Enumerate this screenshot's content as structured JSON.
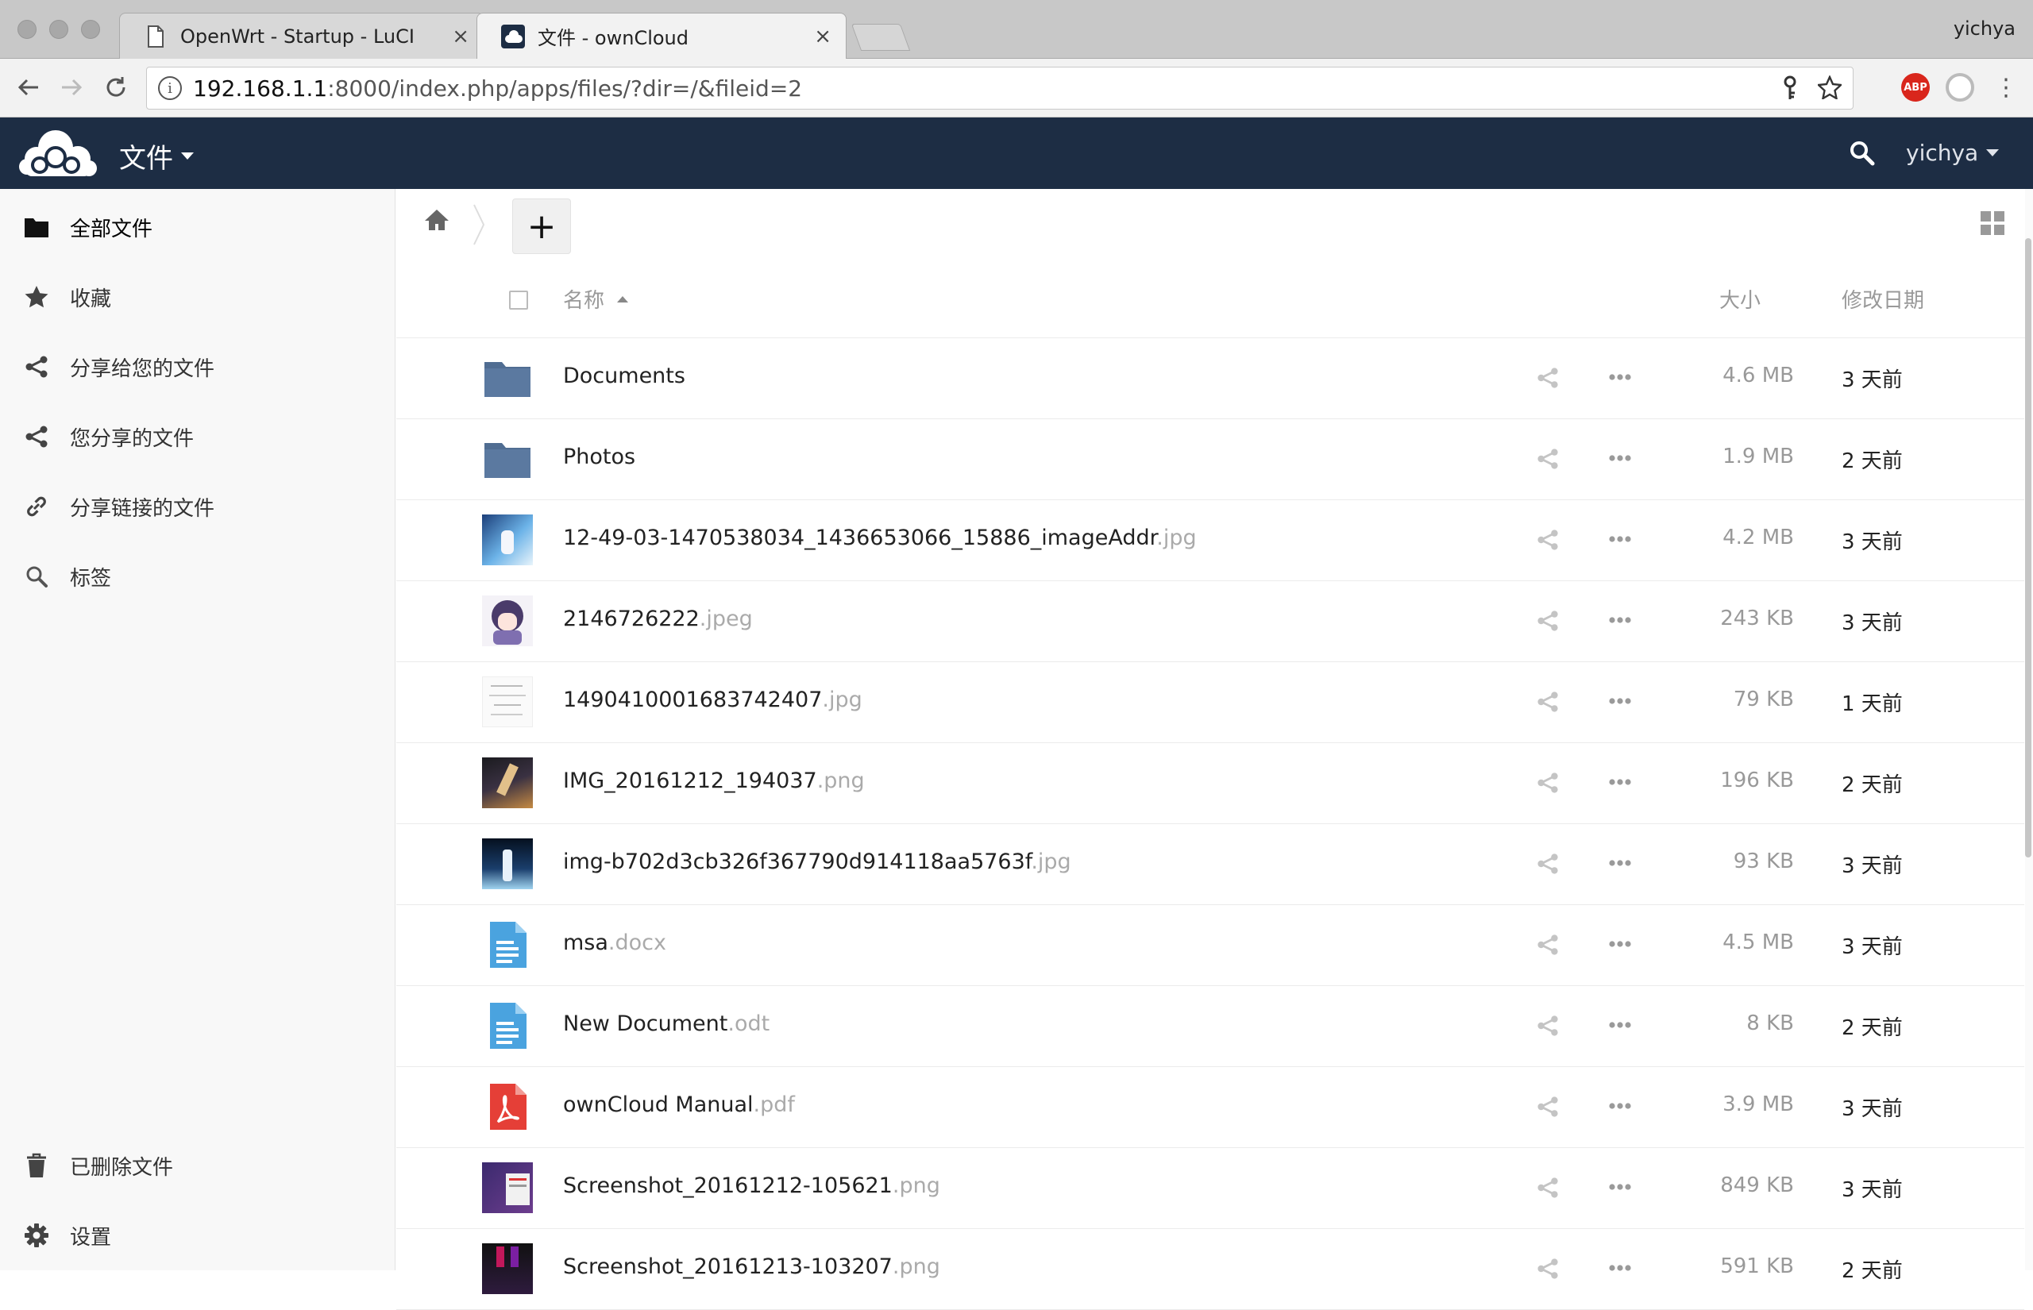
{
  "browser": {
    "tabs": [
      {
        "title": "OpenWrt - Startup - LuCI",
        "active": false
      },
      {
        "title": "文件 - ownCloud",
        "active": true
      }
    ],
    "profile_name": "yichya",
    "url_host": "192.168.1.1",
    "url_rest": ":8000/index.php/apps/files/?dir=/&fileid=2",
    "extensions": [
      "ABP",
      "circle"
    ]
  },
  "header": {
    "app_name": "文件",
    "user_name": "yichya",
    "brand_color": "#1d2d44"
  },
  "sidebar": {
    "items": [
      {
        "label": "全部文件",
        "icon": "folder-icon"
      },
      {
        "label": "收藏",
        "icon": "star-icon"
      },
      {
        "label": "分享给您的文件",
        "icon": "share-icon"
      },
      {
        "label": "您分享的文件",
        "icon": "share-icon"
      },
      {
        "label": "分享链接的文件",
        "icon": "link-icon"
      },
      {
        "label": "标签",
        "icon": "search-icon"
      }
    ],
    "bottom": [
      {
        "label": "已删除文件",
        "icon": "trash-icon"
      },
      {
        "label": "设置",
        "icon": "gear-icon"
      }
    ]
  },
  "controls": {
    "add_label": "+"
  },
  "table": {
    "col_name": "名称",
    "col_size": "大小",
    "col_modified": "修改日期",
    "rows": [
      {
        "name": "Documents",
        "ext": "",
        "size": "4.6 MB",
        "modified": "3 天前",
        "kind": "folder"
      },
      {
        "name": "Photos",
        "ext": "",
        "size": "1.9 MB",
        "modified": "2 天前",
        "kind": "folder"
      },
      {
        "name": "12-49-03-1470538034_1436653066_15886_imageAddr",
        "ext": ".jpg",
        "size": "4.2 MB",
        "modified": "3 天前",
        "kind": "image-blue"
      },
      {
        "name": "2146726222",
        "ext": ".jpeg",
        "size": "243 KB",
        "modified": "3 天前",
        "kind": "image-anime"
      },
      {
        "name": "1490410001683742407",
        "ext": ".jpg",
        "size": "79 KB",
        "modified": "1 天前",
        "kind": "image-sketch"
      },
      {
        "name": "IMG_20161212_194037",
        "ext": ".png",
        "size": "196 KB",
        "modified": "2 天前",
        "kind": "image-dark"
      },
      {
        "name": "img-b702d3cb326f367790d914118aa5763f",
        "ext": ".jpg",
        "size": "93 KB",
        "modified": "3 天前",
        "kind": "image-night"
      },
      {
        "name": "msa",
        "ext": ".docx",
        "size": "4.5 MB",
        "modified": "3 天前",
        "kind": "document"
      },
      {
        "name": "New Document",
        "ext": ".odt",
        "size": "8 KB",
        "modified": "2 天前",
        "kind": "document"
      },
      {
        "name": "ownCloud Manual",
        "ext": ".pdf",
        "size": "3.9 MB",
        "modified": "3 天前",
        "kind": "pdf"
      },
      {
        "name": "Screenshot_20161212-105621",
        "ext": ".png",
        "size": "849 KB",
        "modified": "3 天前",
        "kind": "image-screenshot"
      },
      {
        "name": "Screenshot_20161213-103207",
        "ext": ".png",
        "size": "591 KB",
        "modified": "2 天前",
        "kind": "image-screenshot2"
      }
    ]
  }
}
